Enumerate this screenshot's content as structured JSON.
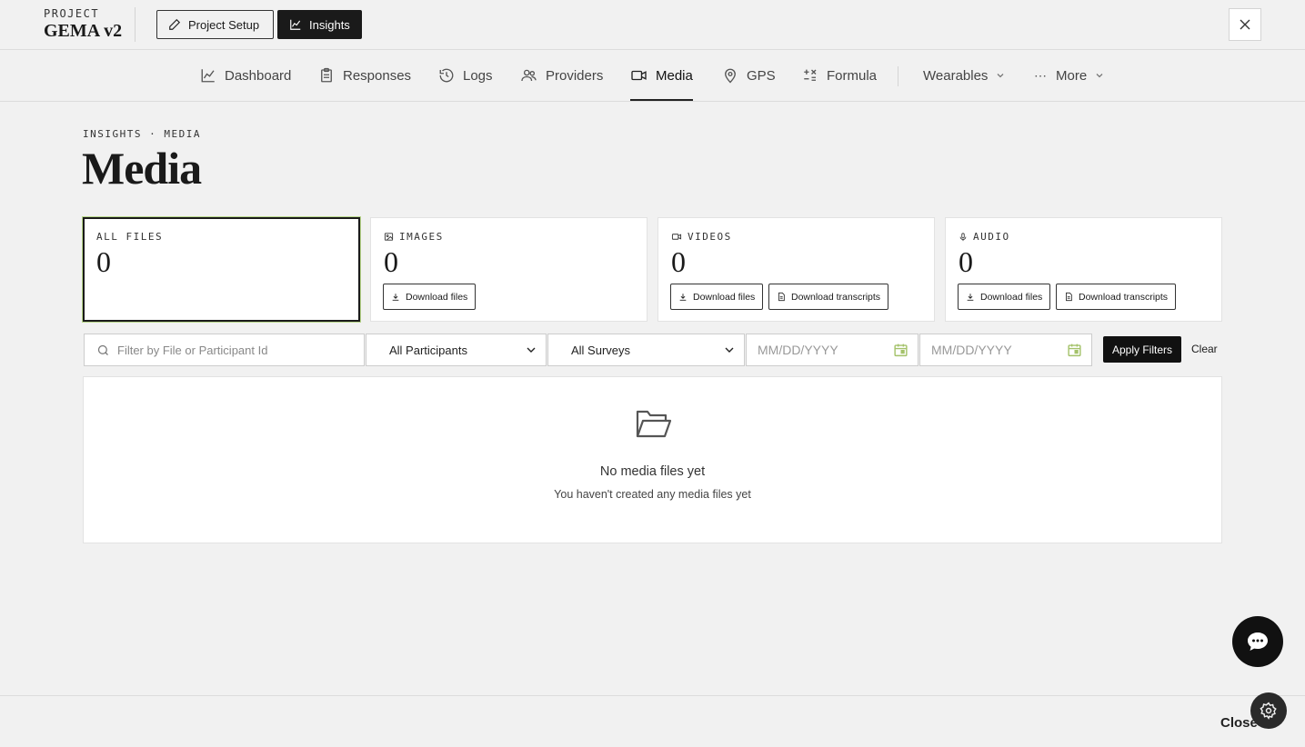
{
  "header": {
    "project_label": "PROJECT",
    "project_name": "GEMA v2",
    "setup_label": "Project Setup",
    "insights_label": "Insights"
  },
  "nav": {
    "items": [
      {
        "label": "Dashboard",
        "icon": "chart-line-icon"
      },
      {
        "label": "Responses",
        "icon": "clipboard-icon"
      },
      {
        "label": "Logs",
        "icon": "history-icon"
      },
      {
        "label": "Providers",
        "icon": "users-icon"
      },
      {
        "label": "Media",
        "icon": "video-icon",
        "active": true
      },
      {
        "label": "GPS",
        "icon": "map-pin-icon"
      },
      {
        "label": "Formula",
        "icon": "formula-icon"
      },
      {
        "label": "Wearables",
        "icon": "chevron-down-icon"
      },
      {
        "label": "More",
        "icon": "ellipsis-icon"
      }
    ]
  },
  "page": {
    "breadcrumb": "INSIGHTS · MEDIA",
    "title": "Media"
  },
  "cards": [
    {
      "label": "ALL FILES",
      "count": "0",
      "selected": true
    },
    {
      "label": "IMAGES",
      "count": "0",
      "buttons": [
        "Download files"
      ]
    },
    {
      "label": "VIDEOS",
      "count": "0",
      "buttons": [
        "Download files",
        "Download transcripts"
      ]
    },
    {
      "label": "AUDIO",
      "count": "0",
      "buttons": [
        "Download files",
        "Download transcripts"
      ]
    }
  ],
  "filters": {
    "search_placeholder": "Filter by File or Participant Id",
    "participants": "All Participants",
    "surveys": "All Surveys",
    "date_placeholder": "MM/DD/YYYY",
    "apply_label": "Apply Filters",
    "clear_label": "Clear"
  },
  "empty": {
    "title": "No media files yet",
    "subtitle": "You haven't created any media files yet"
  },
  "footer": {
    "close_label": "Close"
  },
  "colors": {
    "accent": "#1a1a1a",
    "calendar": "#a4c26a",
    "selected_outline": "#b8d68a"
  }
}
